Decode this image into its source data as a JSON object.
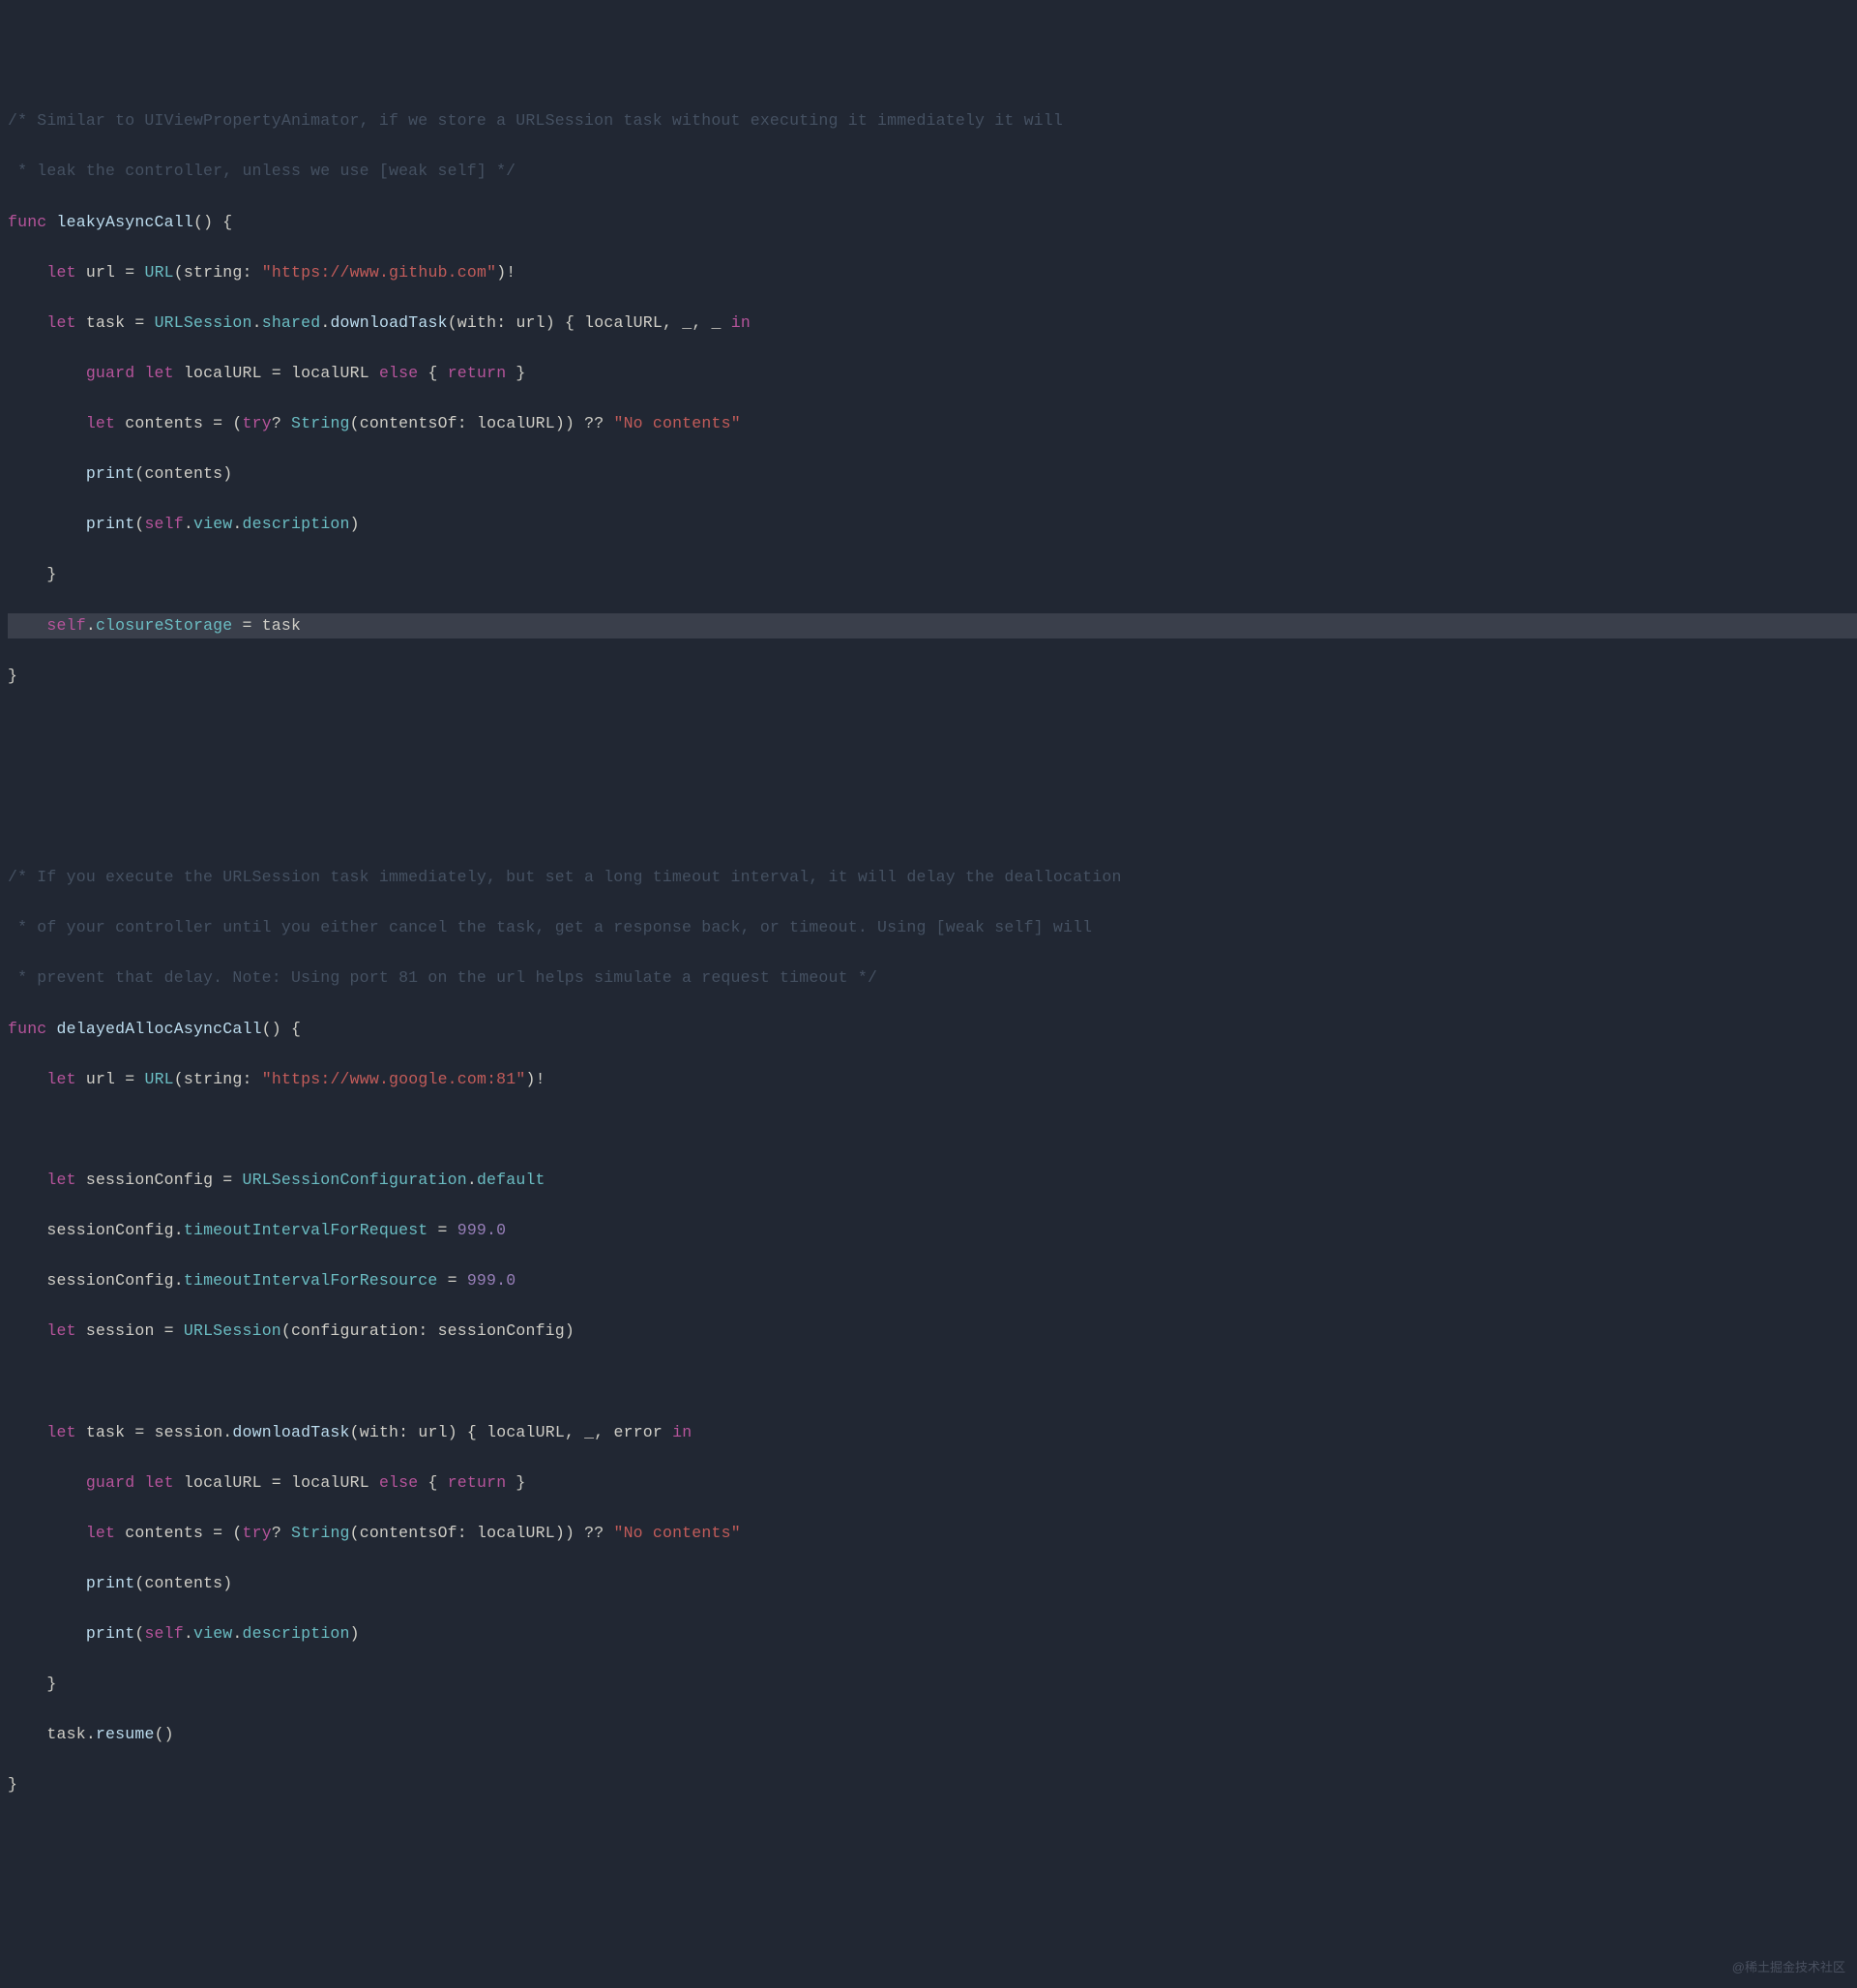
{
  "watermark": "@稀土掘金技术社区",
  "code": [
    {
      "type": "line",
      "tokens": [
        {
          "c": "cm",
          "t": "/* Similar to UIViewPropertyAnimator, if we store a URLSession task without executing it immediately it will"
        }
      ]
    },
    {
      "type": "line",
      "tokens": [
        {
          "c": "cm",
          "t": " * leak the controller, unless we use [weak self] */"
        }
      ]
    },
    {
      "type": "line",
      "tokens": [
        {
          "c": "kw",
          "t": "func"
        },
        {
          "c": "pn",
          "t": " "
        },
        {
          "c": "fn",
          "t": "leakyAsyncCall"
        },
        {
          "c": "pn",
          "t": "() {"
        }
      ]
    },
    {
      "type": "line",
      "tokens": [
        {
          "c": "pn",
          "t": "    "
        },
        {
          "c": "kw",
          "t": "let"
        },
        {
          "c": "pn",
          "t": " "
        },
        {
          "c": "id",
          "t": "url"
        },
        {
          "c": "pn",
          "t": " = "
        },
        {
          "c": "ty",
          "t": "URL"
        },
        {
          "c": "pn",
          "t": "("
        },
        {
          "c": "id",
          "t": "string"
        },
        {
          "c": "pn",
          "t": ": "
        },
        {
          "c": "str",
          "t": "\"https://www.github.com\""
        },
        {
          "c": "pn",
          "t": ")!"
        }
      ]
    },
    {
      "type": "line",
      "tokens": [
        {
          "c": "pn",
          "t": "    "
        },
        {
          "c": "kw",
          "t": "let"
        },
        {
          "c": "pn",
          "t": " "
        },
        {
          "c": "id",
          "t": "task"
        },
        {
          "c": "pn",
          "t": " = "
        },
        {
          "c": "ty",
          "t": "URLSession"
        },
        {
          "c": "pn",
          "t": "."
        },
        {
          "c": "prop",
          "t": "shared"
        },
        {
          "c": "pn",
          "t": "."
        },
        {
          "c": "fn",
          "t": "downloadTask"
        },
        {
          "c": "pn",
          "t": "("
        },
        {
          "c": "id",
          "t": "with"
        },
        {
          "c": "pn",
          "t": ": "
        },
        {
          "c": "id",
          "t": "url"
        },
        {
          "c": "pn",
          "t": ") { "
        },
        {
          "c": "id",
          "t": "localURL"
        },
        {
          "c": "pn",
          "t": ", "
        },
        {
          "c": "id",
          "t": "_"
        },
        {
          "c": "pn",
          "t": ", "
        },
        {
          "c": "id",
          "t": "_"
        },
        {
          "c": "pn",
          "t": " "
        },
        {
          "c": "kw",
          "t": "in"
        }
      ]
    },
    {
      "type": "line",
      "tokens": [
        {
          "c": "pn",
          "t": "        "
        },
        {
          "c": "kw",
          "t": "guard"
        },
        {
          "c": "pn",
          "t": " "
        },
        {
          "c": "kw",
          "t": "let"
        },
        {
          "c": "pn",
          "t": " "
        },
        {
          "c": "id",
          "t": "localURL"
        },
        {
          "c": "pn",
          "t": " = "
        },
        {
          "c": "id",
          "t": "localURL"
        },
        {
          "c": "pn",
          "t": " "
        },
        {
          "c": "kw",
          "t": "else"
        },
        {
          "c": "pn",
          "t": " { "
        },
        {
          "c": "kw",
          "t": "return"
        },
        {
          "c": "pn",
          "t": " }"
        }
      ]
    },
    {
      "type": "line",
      "tokens": [
        {
          "c": "pn",
          "t": "        "
        },
        {
          "c": "kw",
          "t": "let"
        },
        {
          "c": "pn",
          "t": " "
        },
        {
          "c": "id",
          "t": "contents"
        },
        {
          "c": "pn",
          "t": " = ("
        },
        {
          "c": "kw",
          "t": "try"
        },
        {
          "c": "pn",
          "t": "? "
        },
        {
          "c": "ty",
          "t": "String"
        },
        {
          "c": "pn",
          "t": "("
        },
        {
          "c": "id",
          "t": "contentsOf"
        },
        {
          "c": "pn",
          "t": ": "
        },
        {
          "c": "id",
          "t": "localURL"
        },
        {
          "c": "pn",
          "t": ")) ?? "
        },
        {
          "c": "str",
          "t": "\"No contents\""
        }
      ]
    },
    {
      "type": "line",
      "tokens": [
        {
          "c": "pn",
          "t": "        "
        },
        {
          "c": "fn",
          "t": "print"
        },
        {
          "c": "pn",
          "t": "("
        },
        {
          "c": "id",
          "t": "contents"
        },
        {
          "c": "pn",
          "t": ")"
        }
      ]
    },
    {
      "type": "line",
      "tokens": [
        {
          "c": "pn",
          "t": "        "
        },
        {
          "c": "fn",
          "t": "print"
        },
        {
          "c": "pn",
          "t": "("
        },
        {
          "c": "acc",
          "t": "self"
        },
        {
          "c": "pn",
          "t": "."
        },
        {
          "c": "prop",
          "t": "view"
        },
        {
          "c": "pn",
          "t": "."
        },
        {
          "c": "prop",
          "t": "description"
        },
        {
          "c": "pn",
          "t": ")"
        }
      ]
    },
    {
      "type": "line",
      "tokens": [
        {
          "c": "pn",
          "t": "    }"
        }
      ]
    },
    {
      "type": "hl",
      "tokens": [
        {
          "c": "pn",
          "t": "    "
        },
        {
          "c": "acc",
          "t": "self"
        },
        {
          "c": "pn",
          "t": "."
        },
        {
          "c": "prop",
          "t": "closureStorage"
        },
        {
          "c": "pn",
          "t": " = "
        },
        {
          "c": "id",
          "t": "task"
        }
      ]
    },
    {
      "type": "line",
      "tokens": [
        {
          "c": "pn",
          "t": "}"
        }
      ]
    },
    {
      "type": "line",
      "tokens": [
        {
          "c": "pn",
          "t": ""
        }
      ]
    },
    {
      "type": "line",
      "tokens": [
        {
          "c": "pn",
          "t": ""
        }
      ]
    },
    {
      "type": "line",
      "tokens": [
        {
          "c": "pn",
          "t": ""
        }
      ]
    },
    {
      "type": "line",
      "tokens": [
        {
          "c": "cm",
          "t": "/* If you execute the URLSession task immediately, but set a long timeout interval, it will delay the deallocation"
        }
      ]
    },
    {
      "type": "line",
      "tokens": [
        {
          "c": "cm",
          "t": " * of your controller until you either cancel the task, get a response back, or timeout. Using [weak self] will"
        }
      ]
    },
    {
      "type": "line",
      "tokens": [
        {
          "c": "cm",
          "t": " * prevent that delay. Note: Using port 81 on the url helps simulate a request timeout */"
        }
      ]
    },
    {
      "type": "line",
      "tokens": [
        {
          "c": "kw",
          "t": "func"
        },
        {
          "c": "pn",
          "t": " "
        },
        {
          "c": "fn",
          "t": "delayedAllocAsyncCall"
        },
        {
          "c": "pn",
          "t": "() {"
        }
      ]
    },
    {
      "type": "line",
      "tokens": [
        {
          "c": "pn",
          "t": "    "
        },
        {
          "c": "kw",
          "t": "let"
        },
        {
          "c": "pn",
          "t": " "
        },
        {
          "c": "id",
          "t": "url"
        },
        {
          "c": "pn",
          "t": " = "
        },
        {
          "c": "ty",
          "t": "URL"
        },
        {
          "c": "pn",
          "t": "("
        },
        {
          "c": "id",
          "t": "string"
        },
        {
          "c": "pn",
          "t": ": "
        },
        {
          "c": "str",
          "t": "\"https://www.google.com:81\""
        },
        {
          "c": "pn",
          "t": ")!"
        }
      ]
    },
    {
      "type": "line",
      "tokens": [
        {
          "c": "pn",
          "t": ""
        }
      ]
    },
    {
      "type": "line",
      "tokens": [
        {
          "c": "pn",
          "t": "    "
        },
        {
          "c": "kw",
          "t": "let"
        },
        {
          "c": "pn",
          "t": " "
        },
        {
          "c": "id",
          "t": "sessionConfig"
        },
        {
          "c": "pn",
          "t": " = "
        },
        {
          "c": "ty",
          "t": "URLSessionConfiguration"
        },
        {
          "c": "pn",
          "t": "."
        },
        {
          "c": "prop",
          "t": "default"
        }
      ]
    },
    {
      "type": "line",
      "tokens": [
        {
          "c": "pn",
          "t": "    "
        },
        {
          "c": "id",
          "t": "sessionConfig"
        },
        {
          "c": "pn",
          "t": "."
        },
        {
          "c": "prop",
          "t": "timeoutIntervalForRequest"
        },
        {
          "c": "pn",
          "t": " = "
        },
        {
          "c": "num",
          "t": "999.0"
        }
      ]
    },
    {
      "type": "line",
      "tokens": [
        {
          "c": "pn",
          "t": "    "
        },
        {
          "c": "id",
          "t": "sessionConfig"
        },
        {
          "c": "pn",
          "t": "."
        },
        {
          "c": "prop",
          "t": "timeoutIntervalForResource"
        },
        {
          "c": "pn",
          "t": " = "
        },
        {
          "c": "num",
          "t": "999.0"
        }
      ]
    },
    {
      "type": "line",
      "tokens": [
        {
          "c": "pn",
          "t": "    "
        },
        {
          "c": "kw",
          "t": "let"
        },
        {
          "c": "pn",
          "t": " "
        },
        {
          "c": "id",
          "t": "session"
        },
        {
          "c": "pn",
          "t": " = "
        },
        {
          "c": "ty",
          "t": "URLSession"
        },
        {
          "c": "pn",
          "t": "("
        },
        {
          "c": "id",
          "t": "configuration"
        },
        {
          "c": "pn",
          "t": ": "
        },
        {
          "c": "id",
          "t": "sessionConfig"
        },
        {
          "c": "pn",
          "t": ")"
        }
      ]
    },
    {
      "type": "line",
      "tokens": [
        {
          "c": "pn",
          "t": ""
        }
      ]
    },
    {
      "type": "line",
      "tokens": [
        {
          "c": "pn",
          "t": "    "
        },
        {
          "c": "kw",
          "t": "let"
        },
        {
          "c": "pn",
          "t": " "
        },
        {
          "c": "id",
          "t": "task"
        },
        {
          "c": "pn",
          "t": " = "
        },
        {
          "c": "id",
          "t": "session"
        },
        {
          "c": "pn",
          "t": "."
        },
        {
          "c": "fn",
          "t": "downloadTask"
        },
        {
          "c": "pn",
          "t": "("
        },
        {
          "c": "id",
          "t": "with"
        },
        {
          "c": "pn",
          "t": ": "
        },
        {
          "c": "id",
          "t": "url"
        },
        {
          "c": "pn",
          "t": ") { "
        },
        {
          "c": "id",
          "t": "localURL"
        },
        {
          "c": "pn",
          "t": ", "
        },
        {
          "c": "id",
          "t": "_"
        },
        {
          "c": "pn",
          "t": ", "
        },
        {
          "c": "id",
          "t": "error"
        },
        {
          "c": "pn",
          "t": " "
        },
        {
          "c": "kw",
          "t": "in"
        }
      ]
    },
    {
      "type": "line",
      "tokens": [
        {
          "c": "pn",
          "t": "        "
        },
        {
          "c": "kw",
          "t": "guard"
        },
        {
          "c": "pn",
          "t": " "
        },
        {
          "c": "kw",
          "t": "let"
        },
        {
          "c": "pn",
          "t": " "
        },
        {
          "c": "id",
          "t": "localURL"
        },
        {
          "c": "pn",
          "t": " = "
        },
        {
          "c": "id",
          "t": "localURL"
        },
        {
          "c": "pn",
          "t": " "
        },
        {
          "c": "kw",
          "t": "else"
        },
        {
          "c": "pn",
          "t": " { "
        },
        {
          "c": "kw",
          "t": "return"
        },
        {
          "c": "pn",
          "t": " }"
        }
      ]
    },
    {
      "type": "line",
      "tokens": [
        {
          "c": "pn",
          "t": "        "
        },
        {
          "c": "kw",
          "t": "let"
        },
        {
          "c": "pn",
          "t": " "
        },
        {
          "c": "id",
          "t": "contents"
        },
        {
          "c": "pn",
          "t": " = ("
        },
        {
          "c": "kw",
          "t": "try"
        },
        {
          "c": "pn",
          "t": "? "
        },
        {
          "c": "ty",
          "t": "String"
        },
        {
          "c": "pn",
          "t": "("
        },
        {
          "c": "id",
          "t": "contentsOf"
        },
        {
          "c": "pn",
          "t": ": "
        },
        {
          "c": "id",
          "t": "localURL"
        },
        {
          "c": "pn",
          "t": ")) ?? "
        },
        {
          "c": "str",
          "t": "\"No contents\""
        }
      ]
    },
    {
      "type": "line",
      "tokens": [
        {
          "c": "pn",
          "t": "        "
        },
        {
          "c": "fn",
          "t": "print"
        },
        {
          "c": "pn",
          "t": "("
        },
        {
          "c": "id",
          "t": "contents"
        },
        {
          "c": "pn",
          "t": ")"
        }
      ]
    },
    {
      "type": "line",
      "tokens": [
        {
          "c": "pn",
          "t": "        "
        },
        {
          "c": "fn",
          "t": "print"
        },
        {
          "c": "pn",
          "t": "("
        },
        {
          "c": "acc",
          "t": "self"
        },
        {
          "c": "pn",
          "t": "."
        },
        {
          "c": "prop",
          "t": "view"
        },
        {
          "c": "pn",
          "t": "."
        },
        {
          "c": "prop",
          "t": "description"
        },
        {
          "c": "pn",
          "t": ")"
        }
      ]
    },
    {
      "type": "line",
      "tokens": [
        {
          "c": "pn",
          "t": "    }"
        }
      ]
    },
    {
      "type": "line",
      "tokens": [
        {
          "c": "pn",
          "t": "    "
        },
        {
          "c": "id",
          "t": "task"
        },
        {
          "c": "pn",
          "t": "."
        },
        {
          "c": "fn",
          "t": "resume"
        },
        {
          "c": "pn",
          "t": "()"
        }
      ]
    },
    {
      "type": "line",
      "tokens": [
        {
          "c": "pn",
          "t": "}"
        }
      ]
    }
  ]
}
